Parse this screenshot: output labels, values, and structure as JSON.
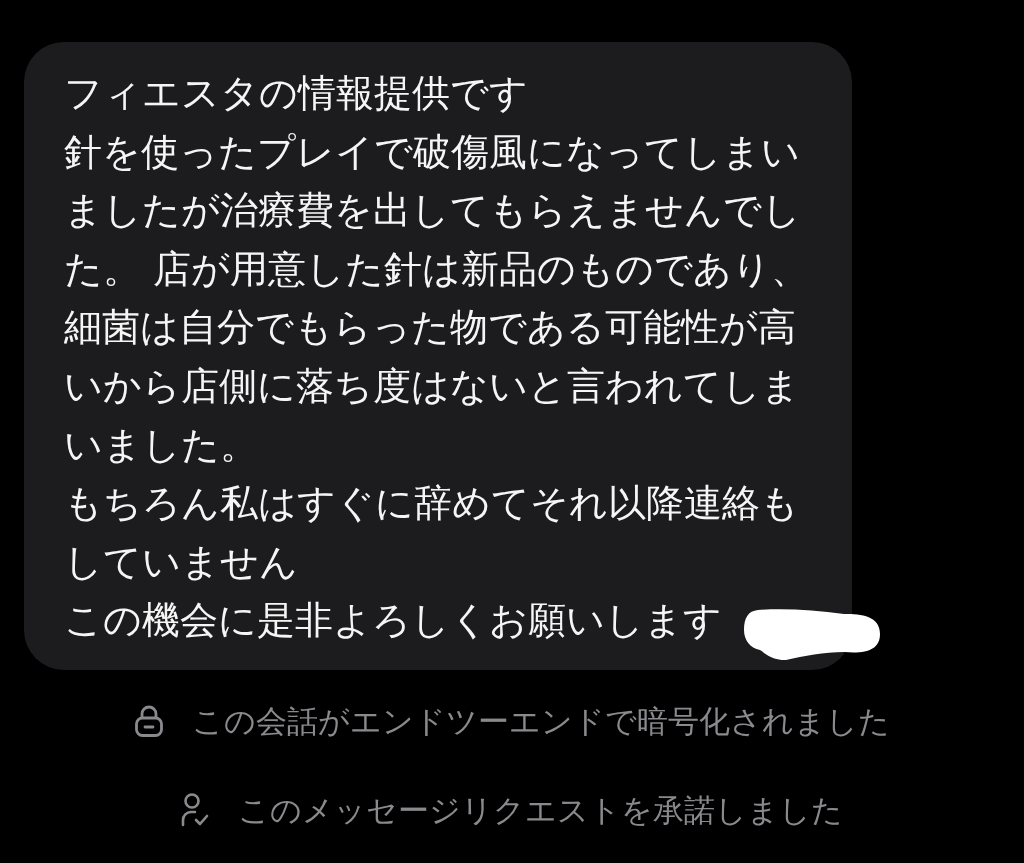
{
  "message": {
    "paragraphs": [
      "フィエスタの情報提供です",
      "針を使ったプレイで破傷風になってしまいましたが治療費を出してもらえませんでした。 店が用意した針は新品のものであり、細菌は自分でもらった物である可能性が高いから店側に落ち度はないと言われてしまいました。",
      "もちろん私はすぐに辞めてそれ以降連絡もしていません",
      "この機会に是非よろしくお願いします"
    ],
    "redacted": true
  },
  "notices": [
    {
      "kind": "encrypted",
      "text": "この会話がエンドツーエンドで暗号化されました"
    },
    {
      "kind": "accepted",
      "text": "このメッセージリクエストを承諾しました"
    }
  ]
}
